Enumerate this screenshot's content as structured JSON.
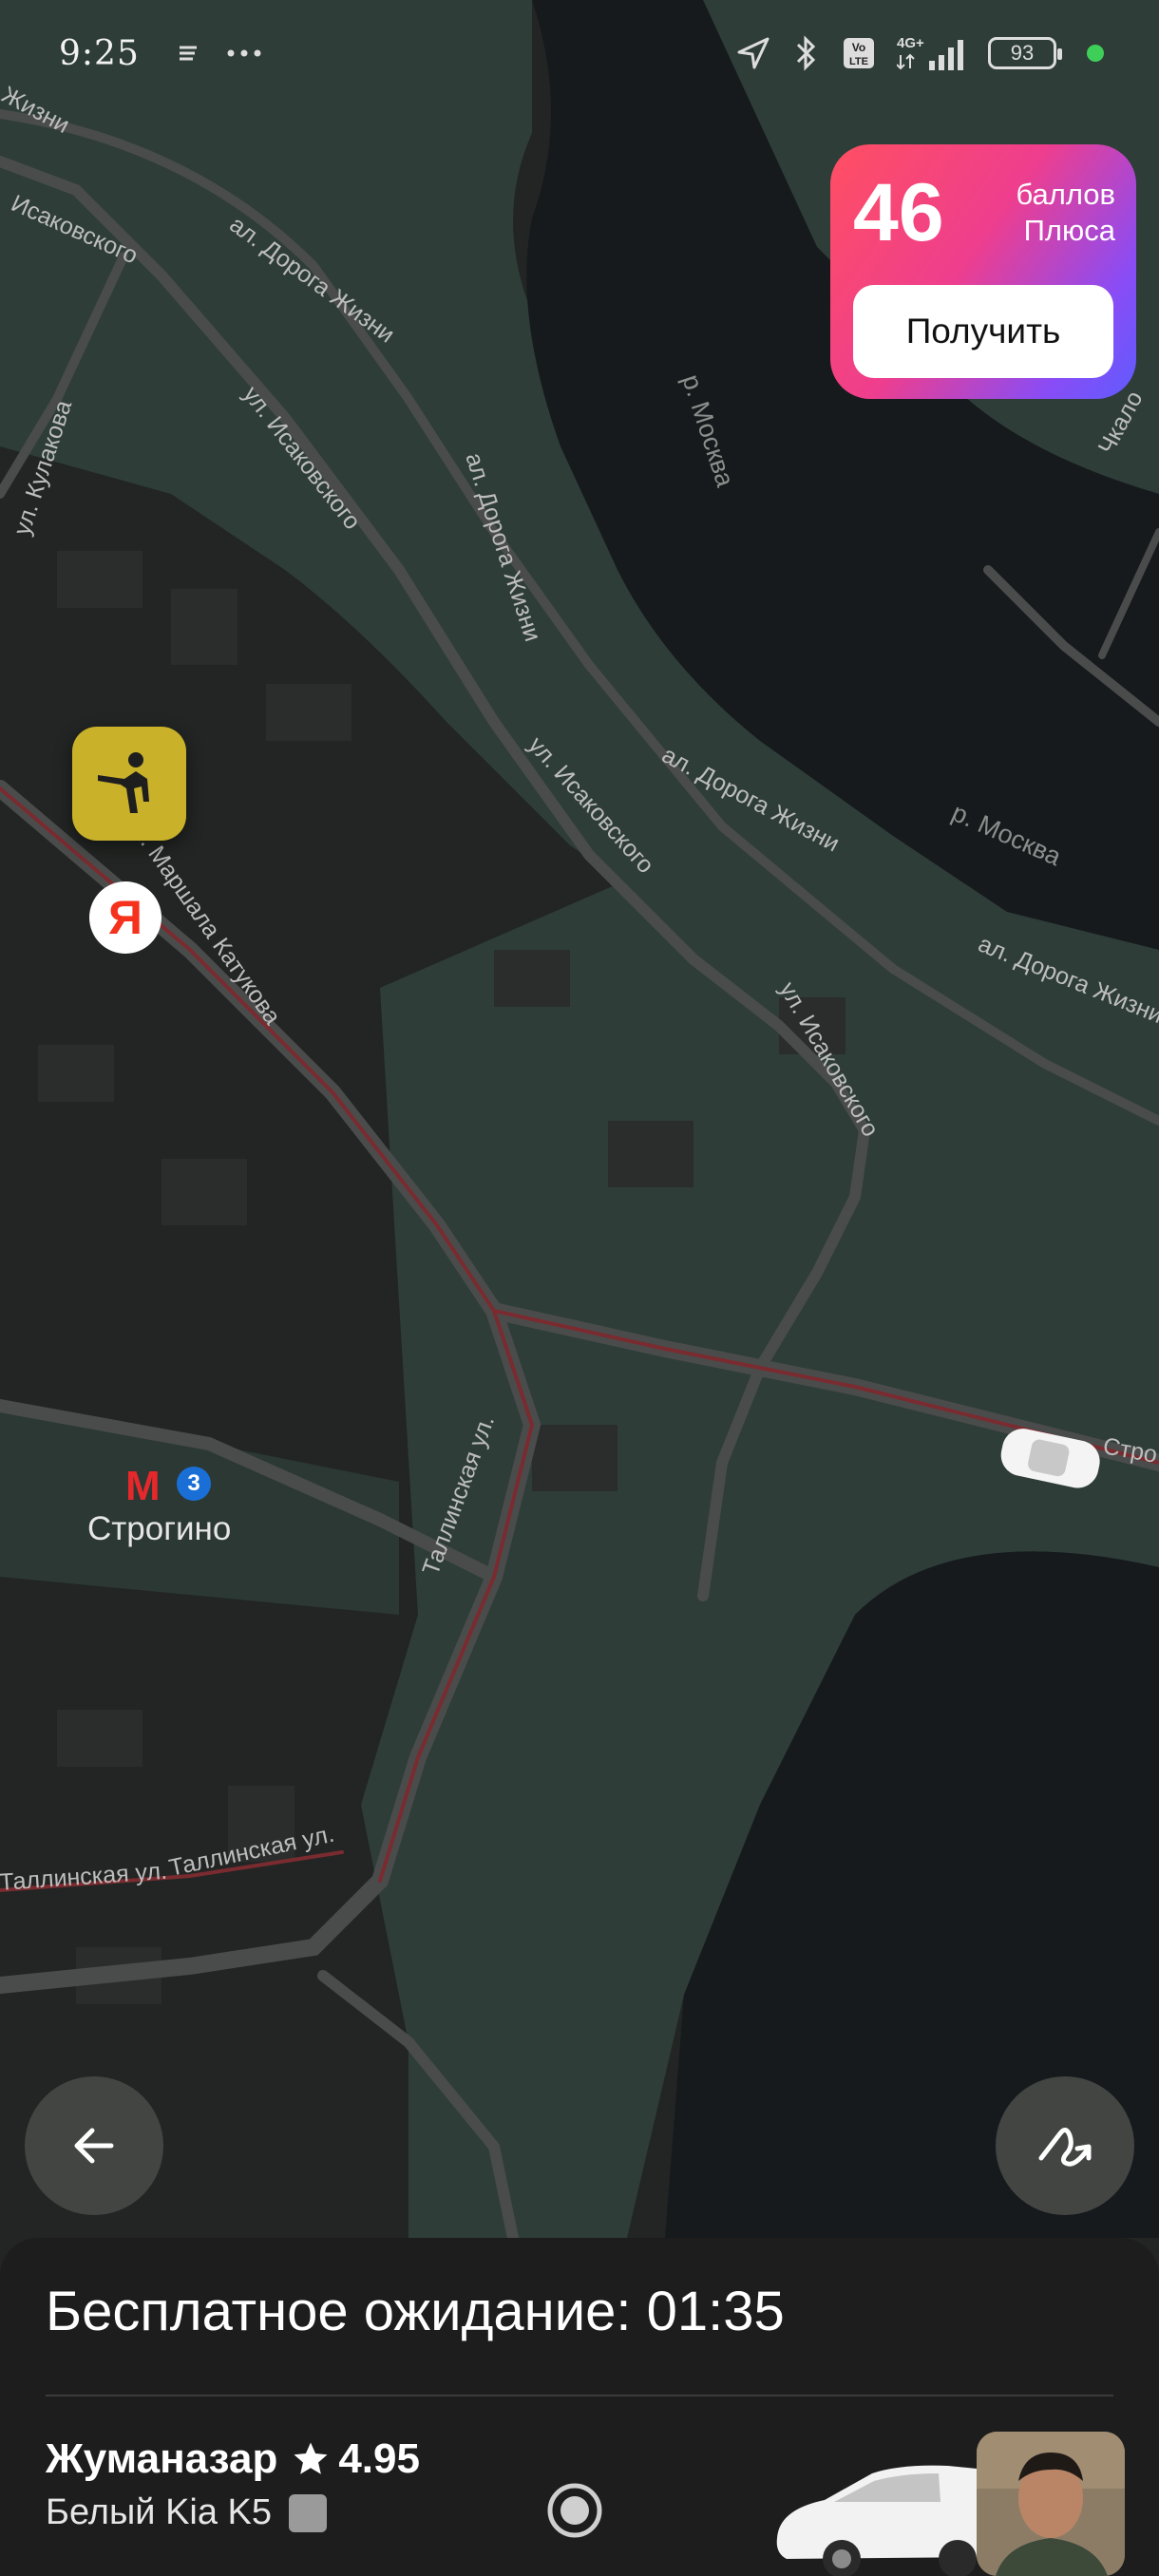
{
  "status_bar": {
    "time": "9:25",
    "battery": "93",
    "icons": [
      "menu-lines-icon",
      "more-dots-icon",
      "location-arrow-icon",
      "bluetooth-icon",
      "volte-icon",
      "signal-4g-icon",
      "battery-icon"
    ]
  },
  "plus_card": {
    "points": "46",
    "label_line1": "баллов",
    "label_line2": "Плюса",
    "button": "Получить"
  },
  "map": {
    "streets": {
      "isakovskogo_1": "Исаковского",
      "isakovskogo_2": "ул. Исаковского",
      "isakovskogo_3": "ул. Исаковского",
      "isakovskogo_4": "ул. Исаковского",
      "doroga_1": "ал. Дорога Жизни",
      "doroga_2": "ал. Дорога Жизни",
      "doroga_3": "ал. Дорога Жизни",
      "doroga_4": "ал. Дорога Жизни",
      "doroga_top": "Жизни",
      "kulakova": "ул. Кулакова",
      "katukova": "ул. Маршала Катукова",
      "tallinskaya_1": "Таллинская ул.",
      "tallinskaya_2": "Таллинская ул.",
      "tallinskaya_3": "Таллинская ул.",
      "chkalov": "Чкало",
      "strog": "Стро"
    },
    "rivers": {
      "moskva_1": "р. Москва",
      "moskva_2": "р. Москва"
    },
    "metro": {
      "letter": "М",
      "line": "3",
      "station": "Строгино"
    },
    "ya_logo": "Я"
  },
  "sheet": {
    "waiting": "Бесплатное ожидание: 01:35",
    "driver_name": "Жуманазар",
    "rating": "4.95",
    "car": "Белый Kia K5"
  },
  "colors": {
    "map_bg": "#222523",
    "park": "#2f3f3a",
    "water": "#161a1d",
    "road": "#4a4c4b",
    "traffic": "#7a2b30",
    "pickup_pin": "#c9b12a",
    "plus_gradient_start": "#ff4f62",
    "plus_gradient_end": "#5f5cff"
  }
}
